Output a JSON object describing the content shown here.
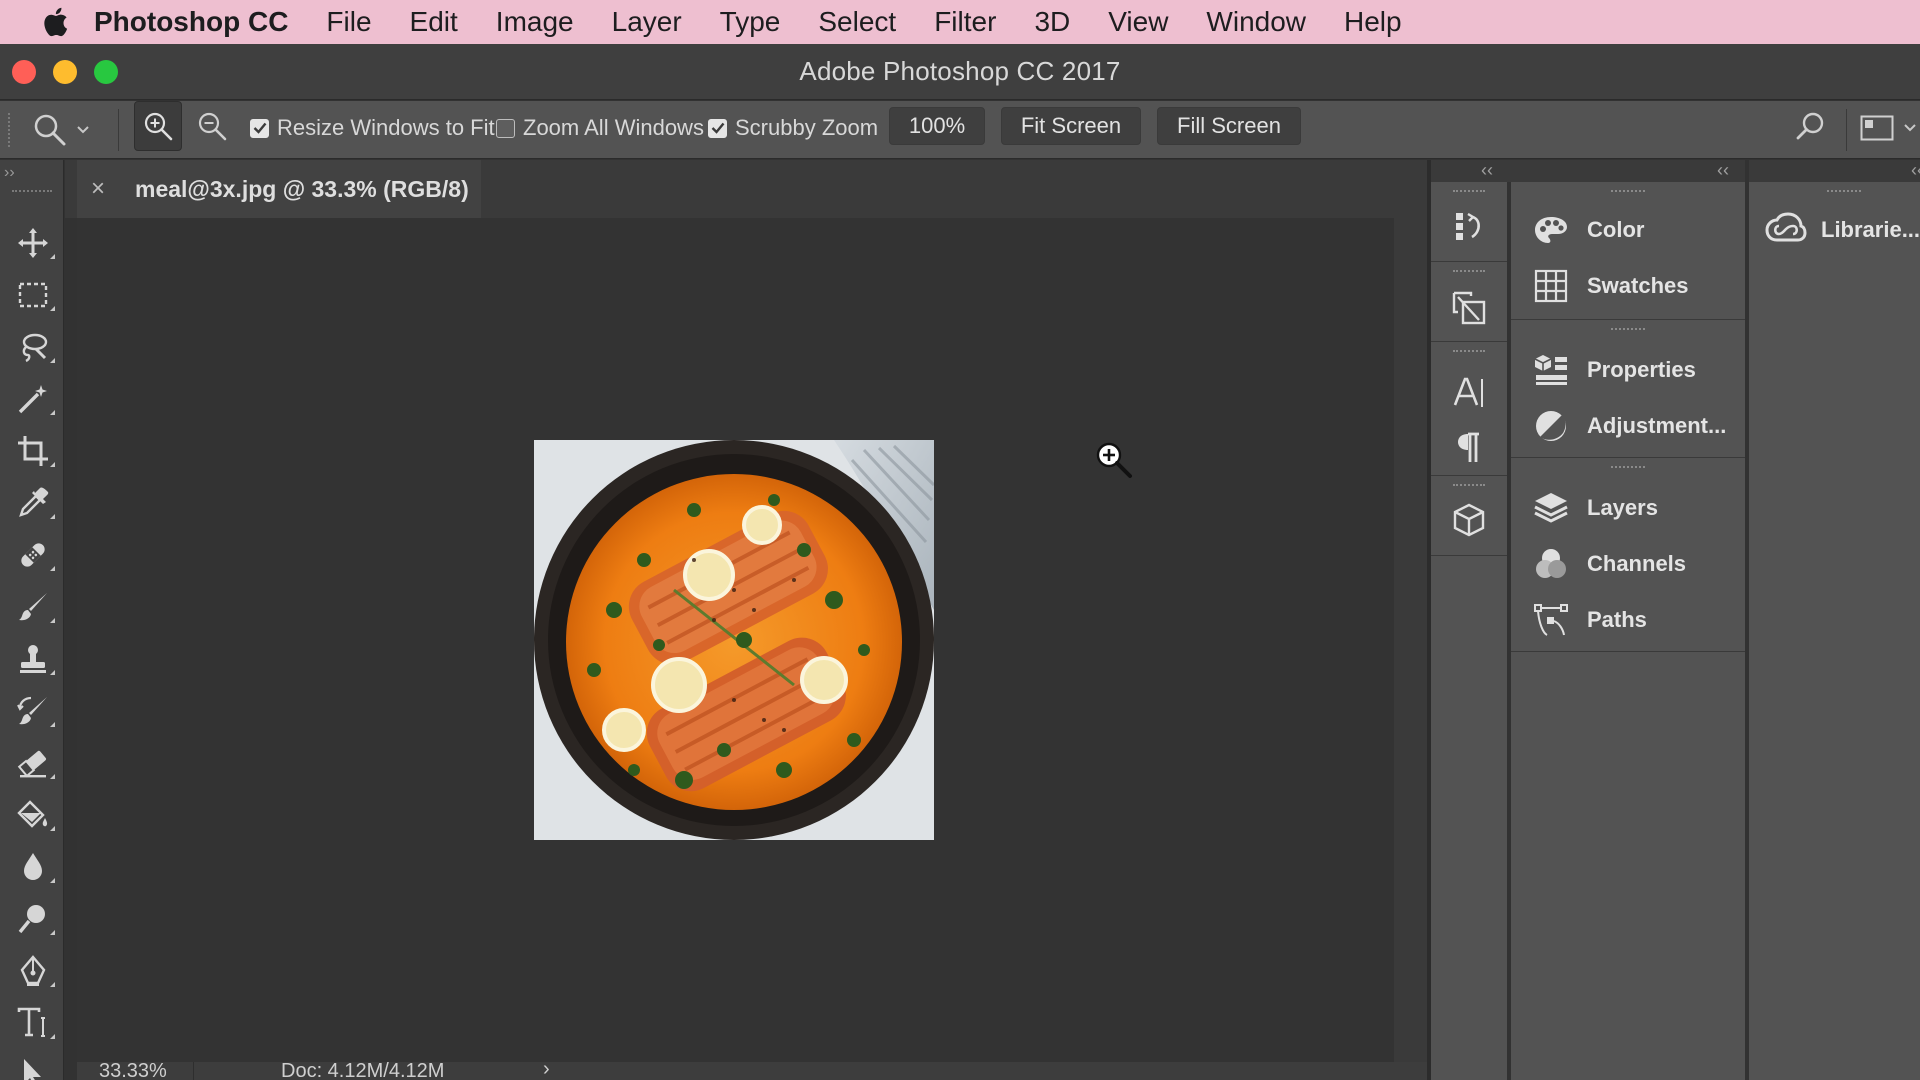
{
  "menubar": {
    "app_name": "Photoshop CC",
    "items": [
      "File",
      "Edit",
      "Image",
      "Layer",
      "Type",
      "Select",
      "Filter",
      "3D",
      "View",
      "Window",
      "Help"
    ]
  },
  "window": {
    "title": "Adobe Photoshop CC 2017"
  },
  "options_bar": {
    "resize_windows": {
      "label": "Resize Windows to Fit",
      "checked": true
    },
    "zoom_all": {
      "label": "Zoom All Windows",
      "checked": false
    },
    "scrubby_zoom": {
      "label": "Scrubby Zoom",
      "checked": true
    },
    "zoom_percent": "100%",
    "fit_screen": "Fit Screen",
    "fill_screen": "Fill Screen"
  },
  "document": {
    "tab_title": "meal@3x.jpg @ 33.3% (RGB/8)",
    "close_glyph": "×"
  },
  "status": {
    "zoom": "33.33%",
    "doc_info": "Doc: 4.12M/4.12M",
    "arrow": "›"
  },
  "panels": {
    "collapse_glyph": "‹‹",
    "groups": [
      {
        "items": [
          {
            "label": "Color",
            "icon": "color-palette-icon"
          },
          {
            "label": "Swatches",
            "icon": "swatches-grid-icon"
          }
        ]
      },
      {
        "items": [
          {
            "label": "Properties",
            "icon": "properties-icon"
          },
          {
            "label": "Adjustment...",
            "icon": "adjustments-icon"
          }
        ]
      },
      {
        "items": [
          {
            "label": "Layers",
            "icon": "layers-icon"
          },
          {
            "label": "Channels",
            "icon": "channels-icon"
          },
          {
            "label": "Paths",
            "icon": "paths-icon"
          }
        ]
      }
    ],
    "libraries": {
      "label": "Librarie...",
      "icon": "creative-cloud-icon"
    }
  },
  "colors": {
    "menubar_bg": "#eebfd0",
    "traffic_red": "#ff5f57",
    "traffic_yellow": "#febc2e",
    "traffic_green": "#28c840"
  }
}
